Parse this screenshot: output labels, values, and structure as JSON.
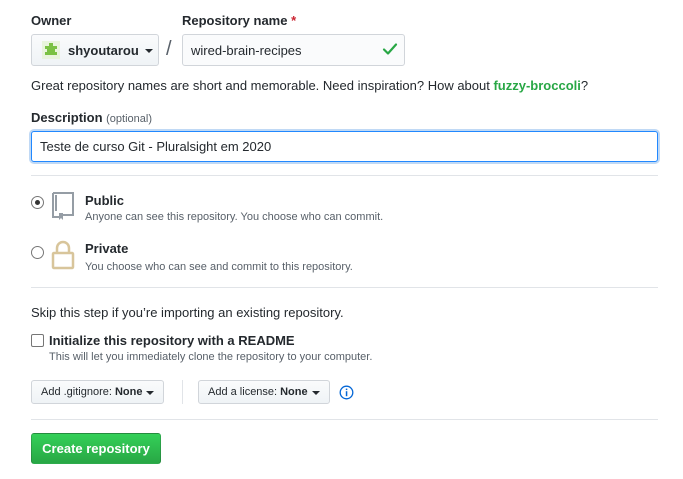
{
  "owner": {
    "label": "Owner",
    "username": "shyoutarou",
    "avatar_color": "#7ac143"
  },
  "repository": {
    "label": "Repository name",
    "required_mark": "*",
    "value": "wired-brain-recipes",
    "valid_icon": "check-icon",
    "valid_color": "#28a745"
  },
  "hint": {
    "text": "Great repository names are short and memorable. Need inspiration? How about ",
    "suggestion": "fuzzy-broccoli",
    "end": "?"
  },
  "description": {
    "label": "Description",
    "optional": "(optional)",
    "value": "Teste de curso Git - Pluralsight em 2020"
  },
  "visibility": {
    "selected": "public",
    "options": [
      {
        "key": "public",
        "title": "Public",
        "desc": "Anyone can see this repository. You choose who can commit.",
        "icon": "repo-icon"
      },
      {
        "key": "private",
        "title": "Private",
        "desc": "You choose who can see and commit to this repository.",
        "icon": "lock-icon"
      }
    ]
  },
  "init": {
    "skip_text": "Skip this step if you’re importing an existing repository.",
    "readme_label": "Initialize this repository with a README",
    "readme_desc": "This will let you immediately clone the repository to your computer.",
    "readme_checked": false
  },
  "gitignore": {
    "prefix": "Add .gitignore:",
    "value": "None"
  },
  "license": {
    "prefix": "Add a license:",
    "value": "None"
  },
  "info_icon": "info-icon",
  "create_button": {
    "label": "Create repository",
    "color": "#28a745"
  }
}
